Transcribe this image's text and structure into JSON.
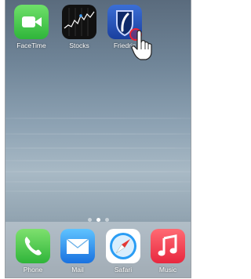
{
  "home": {
    "apps": [
      {
        "label": "FaceTime",
        "icon": "facetime-icon"
      },
      {
        "label": "Stocks",
        "icon": "stocks-icon"
      },
      {
        "label": "Friedric",
        "icon": "friedrich-app-icon"
      }
    ],
    "page_indicator": {
      "count": 3,
      "current": 2
    }
  },
  "dock": {
    "apps": [
      {
        "label": "Phone",
        "icon": "phone-icon"
      },
      {
        "label": "Mail",
        "icon": "mail-icon"
      },
      {
        "label": "Safari",
        "icon": "safari-icon"
      },
      {
        "label": "Music",
        "icon": "music-icon"
      }
    ]
  },
  "pointer": {
    "icon": "hand-pointer-icon"
  }
}
